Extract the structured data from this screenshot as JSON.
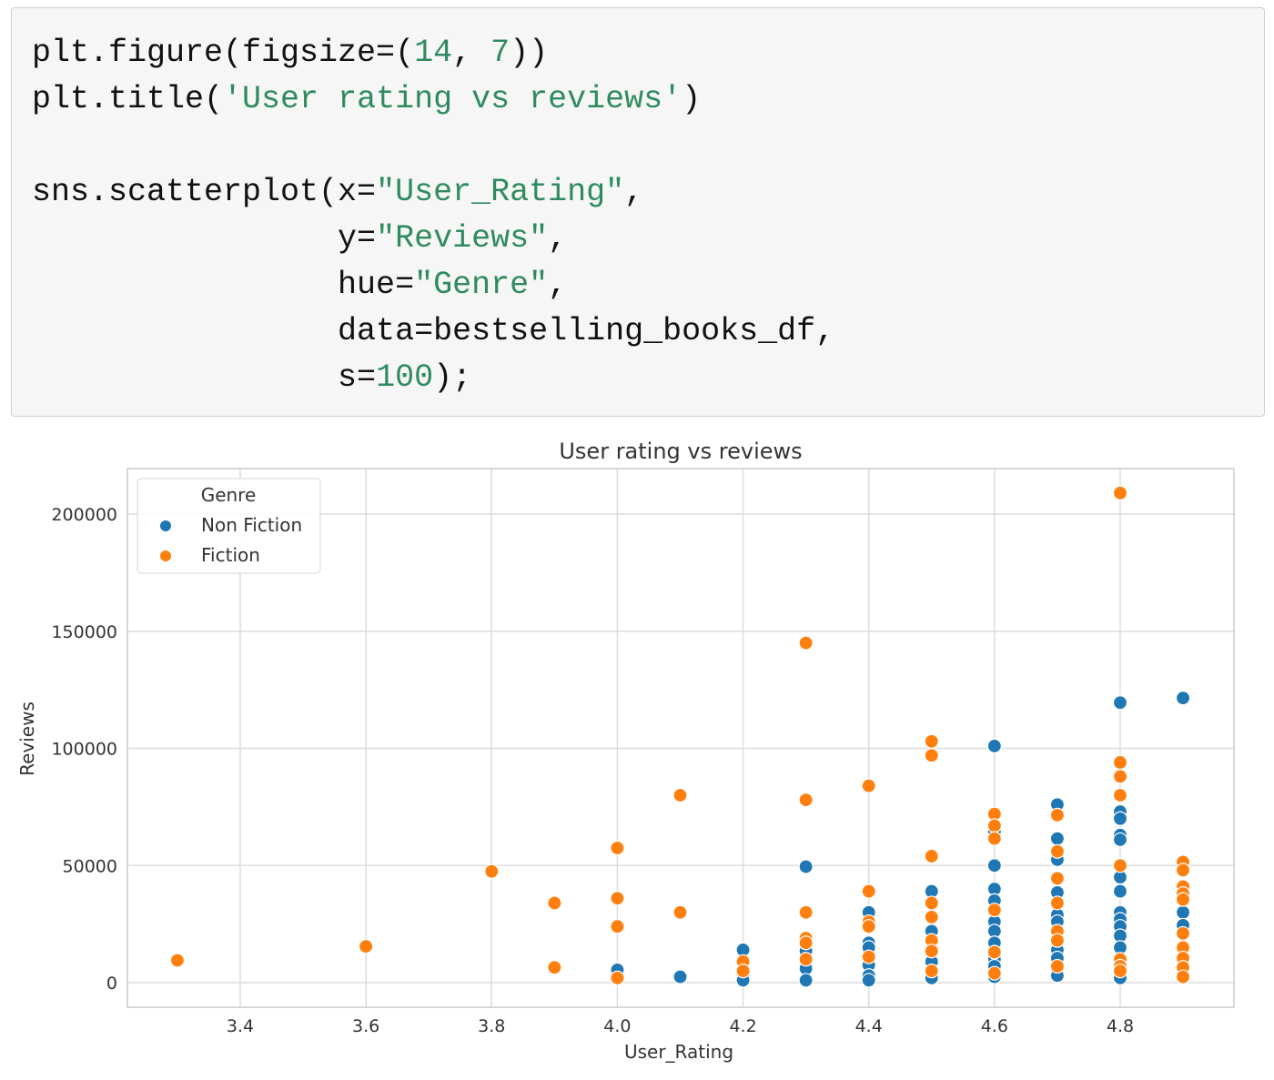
{
  "code": {
    "lines": [
      [
        {
          "t": "plt.figure(figsize=("
        },
        {
          "t": "14",
          "s": 1
        },
        {
          "t": ", "
        },
        {
          "t": "7",
          "s": 1
        },
        {
          "t": "))"
        }
      ],
      [
        {
          "t": "plt.title("
        },
        {
          "t": "'User rating vs reviews'",
          "s": 1
        },
        {
          "t": ")"
        }
      ],
      [
        {
          "t": ""
        }
      ],
      [
        {
          "t": "sns.scatterplot(x="
        },
        {
          "t": "\"User_Rating\"",
          "s": 1
        },
        {
          "t": ","
        }
      ],
      [
        {
          "t": "                y="
        },
        {
          "t": "\"Reviews\"",
          "s": 1
        },
        {
          "t": ","
        }
      ],
      [
        {
          "t": "                hue="
        },
        {
          "t": "\"Genre\"",
          "s": 1
        },
        {
          "t": ","
        }
      ],
      [
        {
          "t": "                data=bestselling_books_df,"
        }
      ],
      [
        {
          "t": "                s="
        },
        {
          "t": "100",
          "s": 1
        },
        {
          "t": ");"
        }
      ]
    ]
  },
  "chart_data": {
    "type": "scatter",
    "title": "User rating vs reviews",
    "xlabel": "User_Rating",
    "ylabel": "Reviews",
    "xlim": [
      3.25,
      4.95
    ],
    "ylim": [
      -10000,
      220000
    ],
    "xticks": [
      3.4,
      3.6,
      3.8,
      4.0,
      4.2,
      4.4,
      4.6,
      4.8
    ],
    "xtick_labels": [
      "3.4",
      "3.6",
      "3.8",
      "4.0",
      "4.2",
      "4.4",
      "4.6",
      "4.8"
    ],
    "yticks": [
      0,
      50000,
      100000,
      150000,
      200000
    ],
    "ytick_labels": [
      "0",
      "50000",
      "100000",
      "150000",
      "200000"
    ],
    "grid": true,
    "legend": {
      "title": "Genre",
      "placement": "top-left",
      "entries": [
        "Non Fiction",
        "Fiction"
      ]
    },
    "colors": {
      "Non Fiction": "#1f77b4",
      "Fiction": "#ff7f0e"
    },
    "series": [
      {
        "name": "Non Fiction",
        "points": [
          [
            4.0,
            5500
          ],
          [
            4.1,
            2500
          ],
          [
            4.2,
            14000
          ],
          [
            4.2,
            3000
          ],
          [
            4.2,
            1000
          ],
          [
            4.3,
            49500
          ],
          [
            4.3,
            13500
          ],
          [
            4.3,
            6000
          ],
          [
            4.3,
            1000
          ],
          [
            4.4,
            30000
          ],
          [
            4.4,
            17000
          ],
          [
            4.4,
            15000
          ],
          [
            4.4,
            7500
          ],
          [
            4.4,
            3000
          ],
          [
            4.4,
            1000
          ],
          [
            4.5,
            39000
          ],
          [
            4.5,
            22000
          ],
          [
            4.5,
            9000
          ],
          [
            4.5,
            2000
          ],
          [
            4.6,
            101000
          ],
          [
            4.6,
            64500
          ],
          [
            4.6,
            50000
          ],
          [
            4.6,
            40000
          ],
          [
            4.6,
            35000
          ],
          [
            4.6,
            26000
          ],
          [
            4.6,
            22000
          ],
          [
            4.6,
            17000
          ],
          [
            4.6,
            10000
          ],
          [
            4.6,
            7000
          ],
          [
            4.6,
            2500
          ],
          [
            4.7,
            76000
          ],
          [
            4.7,
            61500
          ],
          [
            4.7,
            52500
          ],
          [
            4.7,
            38500
          ],
          [
            4.7,
            29000
          ],
          [
            4.7,
            26000
          ],
          [
            4.7,
            14000
          ],
          [
            4.7,
            10500
          ],
          [
            4.7,
            3000
          ],
          [
            4.8,
            119500
          ],
          [
            4.8,
            73000
          ],
          [
            4.8,
            70000
          ],
          [
            4.8,
            63000
          ],
          [
            4.8,
            61000
          ],
          [
            4.8,
            45000
          ],
          [
            4.8,
            39000
          ],
          [
            4.8,
            30000
          ],
          [
            4.8,
            27000
          ],
          [
            4.8,
            24000
          ],
          [
            4.8,
            20000
          ],
          [
            4.8,
            15000
          ],
          [
            4.8,
            2000
          ],
          [
            4.9,
            121500
          ],
          [
            4.9,
            30000
          ],
          [
            4.9,
            24500
          ],
          [
            4.9,
            5500
          ]
        ]
      },
      {
        "name": "Fiction",
        "points": [
          [
            3.3,
            9500
          ],
          [
            3.6,
            15500
          ],
          [
            3.8,
            47500
          ],
          [
            3.9,
            34000
          ],
          [
            3.9,
            6500
          ],
          [
            4.0,
            57500
          ],
          [
            4.0,
            36000
          ],
          [
            4.0,
            24000
          ],
          [
            4.0,
            2000
          ],
          [
            4.1,
            80000
          ],
          [
            4.1,
            30000
          ],
          [
            4.2,
            9000
          ],
          [
            4.2,
            5000
          ],
          [
            4.3,
            145000
          ],
          [
            4.3,
            78000
          ],
          [
            4.3,
            30000
          ],
          [
            4.3,
            19000
          ],
          [
            4.3,
            17000
          ],
          [
            4.3,
            10000
          ],
          [
            4.4,
            84000
          ],
          [
            4.4,
            39000
          ],
          [
            4.4,
            26000
          ],
          [
            4.4,
            24000
          ],
          [
            4.4,
            11000
          ],
          [
            4.5,
            103000
          ],
          [
            4.5,
            97000
          ],
          [
            4.5,
            54000
          ],
          [
            4.5,
            34000
          ],
          [
            4.5,
            28000
          ],
          [
            4.5,
            18000
          ],
          [
            4.5,
            13500
          ],
          [
            4.5,
            5000
          ],
          [
            4.6,
            72000
          ],
          [
            4.6,
            67000
          ],
          [
            4.6,
            61500
          ],
          [
            4.6,
            31000
          ],
          [
            4.6,
            13000
          ],
          [
            4.6,
            4000
          ],
          [
            4.7,
            71500
          ],
          [
            4.7,
            56000
          ],
          [
            4.7,
            44500
          ],
          [
            4.7,
            34000
          ],
          [
            4.7,
            22000
          ],
          [
            4.7,
            18000
          ],
          [
            4.7,
            7000
          ],
          [
            4.8,
            209000
          ],
          [
            4.8,
            94000
          ],
          [
            4.8,
            88000
          ],
          [
            4.8,
            80000
          ],
          [
            4.8,
            50000
          ],
          [
            4.8,
            10000
          ],
          [
            4.8,
            7000
          ],
          [
            4.8,
            5000
          ],
          [
            4.9,
            51500
          ],
          [
            4.9,
            48000
          ],
          [
            4.9,
            41000
          ],
          [
            4.9,
            38000
          ],
          [
            4.9,
            35500
          ],
          [
            4.9,
            21000
          ],
          [
            4.9,
            15000
          ],
          [
            4.9,
            10500
          ],
          [
            4.9,
            6500
          ],
          [
            4.9,
            2500
          ]
        ]
      }
    ]
  }
}
